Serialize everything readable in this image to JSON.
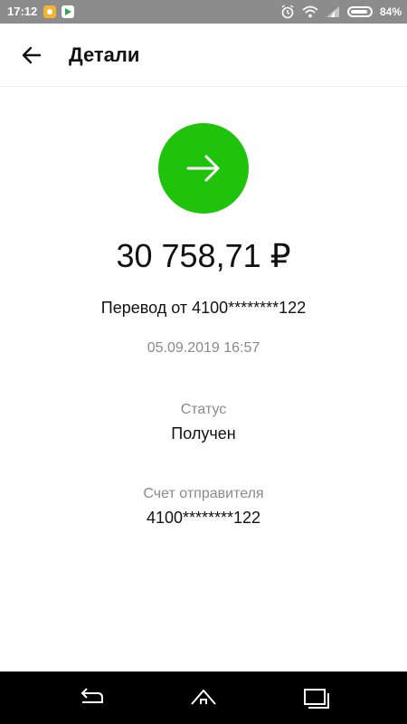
{
  "status_bar": {
    "time": "17:12",
    "battery": "84%",
    "icons": [
      "app-notification-icon",
      "play-store-icon",
      "alarm-icon",
      "wifi-icon",
      "signal-icon",
      "battery-icon"
    ]
  },
  "header": {
    "title": "Детали",
    "back_icon": "arrow-left-icon"
  },
  "transaction": {
    "icon": "arrow-right-icon",
    "icon_color": "#20c30c",
    "amount": "30 758,71 ₽",
    "description": "Перевод от 4100********122",
    "datetime": "05.09.2019 16:57",
    "status_label": "Статус",
    "status_value": "Получен",
    "sender_label": "Счет отправителя",
    "sender_value": "4100********122"
  },
  "nav_bar": {
    "icons": [
      "back-nav-icon",
      "home-nav-icon",
      "recents-nav-icon"
    ]
  }
}
